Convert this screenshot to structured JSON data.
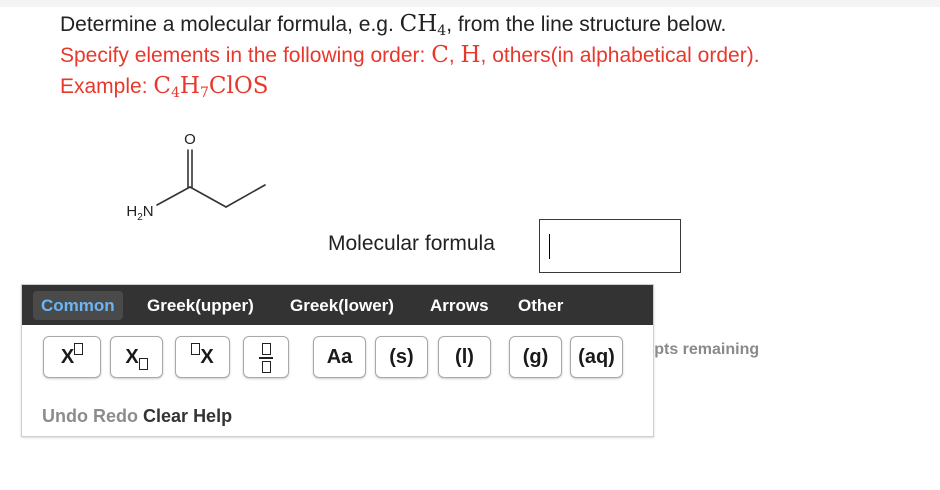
{
  "question": {
    "line1_prefix": "Determine a molecular formula, e.g. ",
    "line1_example": "CH",
    "line1_example_sub": "4",
    "line1_suffix": ", from the line structure below.",
    "line2_prefix": "Specify elements in the following order: ",
    "line2_c": "C",
    "line2_sep1": ", ",
    "line2_h": "H",
    "line2_suffix": ", others(in alphabetical order).",
    "line3_prefix": "Example: ",
    "line3_formula": {
      "c": "C",
      "c_sub": "4",
      "h": "H",
      "h_sub": "7",
      "rest": "ClOS"
    }
  },
  "molecule": {
    "atom_o": "O",
    "atom_n": "N",
    "atom_h": "H",
    "atom_h_sub": "2"
  },
  "answer": {
    "label": "Molecular formula",
    "value": ""
  },
  "palette": {
    "tabs": [
      "Common",
      "Greek(upper)",
      "Greek(lower)",
      "Arrows",
      "Other"
    ],
    "active_tab": "Common",
    "buttons": {
      "superscript_x": "X",
      "subscript_x": "X",
      "prefix_x": "X",
      "aa": "Aa",
      "solid": "(s)",
      "liquid": "(l)",
      "gas": "(g)",
      "aqueous": "(aq)"
    },
    "footer": {
      "undo": "Undo",
      "redo": "Redo",
      "clear": "Clear",
      "help": "Help"
    }
  },
  "attempts_text": "mpts remaining",
  "colors": {
    "instruction_red": "#e8382c",
    "tab_bar": "#333333",
    "active_tab_text": "#6cb4f4"
  }
}
